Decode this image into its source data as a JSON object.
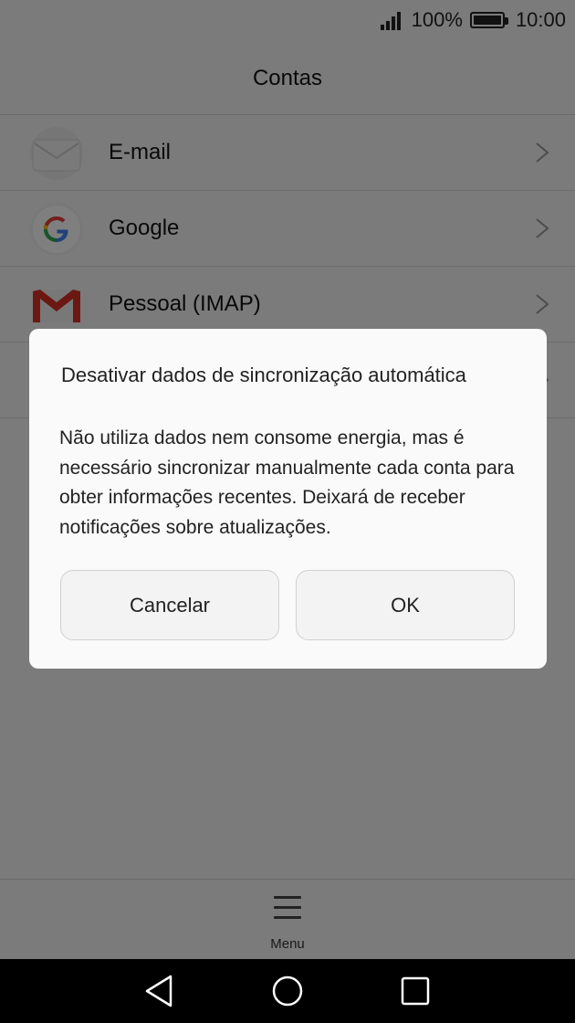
{
  "status_bar": {
    "battery_percent": "100%",
    "time": "10:00",
    "signal_icon": "signal-bars-icon",
    "battery_icon": "battery-full-icon"
  },
  "header": {
    "title": "Contas"
  },
  "accounts": [
    {
      "label": "E-mail",
      "icon": "envelope-icon"
    },
    {
      "label": "Google",
      "icon": "google-g-icon"
    },
    {
      "label": "Pessoal (IMAP)",
      "icon": "gmail-m-icon"
    }
  ],
  "dialog": {
    "title": "Desativar dados de sincronização automática",
    "message": "Não utiliza dados nem consome energia, mas é necessário sincronizar manualmente cada conta para obter informações recentes. Deixará de receber notificações sobre atualizações.",
    "cancel_label": "Cancelar",
    "ok_label": "OK"
  },
  "bottom_bar": {
    "menu_label": "Menu",
    "menu_icon": "hamburger-menu-icon"
  },
  "nav_bar": {
    "back_icon": "back-triangle-icon",
    "home_icon": "home-circle-icon",
    "recents_icon": "recents-square-icon"
  },
  "colors": {
    "scrim": "#000000",
    "gmail_red": "#d93025",
    "google_blue": "#4285f4"
  }
}
